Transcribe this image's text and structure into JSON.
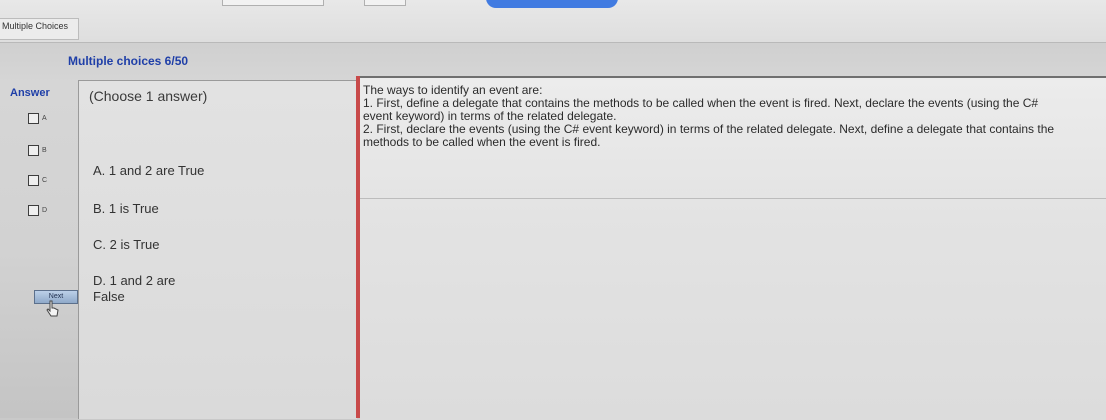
{
  "window": {
    "tab_label": "Multiple Choices"
  },
  "header": {
    "title": "Multiple choices 6/50"
  },
  "answer": {
    "label": "Answer",
    "choices": [
      {
        "letter": "A"
      },
      {
        "letter": "B"
      },
      {
        "letter": "C"
      },
      {
        "letter": "D"
      }
    ],
    "next_label": "Next"
  },
  "options": {
    "instruction": "(Choose 1 answer)",
    "items": [
      {
        "text": "A. 1 and 2 are True"
      },
      {
        "text": "B. 1 is True"
      },
      {
        "text": "C. 2 is True"
      },
      {
        "text": "D. 1 and 2 are False"
      }
    ]
  },
  "question": {
    "lines": [
      "The ways to identify an event are:",
      "1. First, define a delegate that contains the methods to be called when the event is fired. Next, declare the events (using the C# event keyword) in terms of the related delegate.",
      "2. First, declare the events (using the C# event keyword) in terms of the related delegate. Next, define a delegate that contains the methods to be called when the event is fired."
    ]
  },
  "colors": {
    "accent_blue": "#1f3fa8",
    "divider_red": "#c84a4a"
  },
  "icons": {
    "cursor": "hand-cursor-icon"
  }
}
